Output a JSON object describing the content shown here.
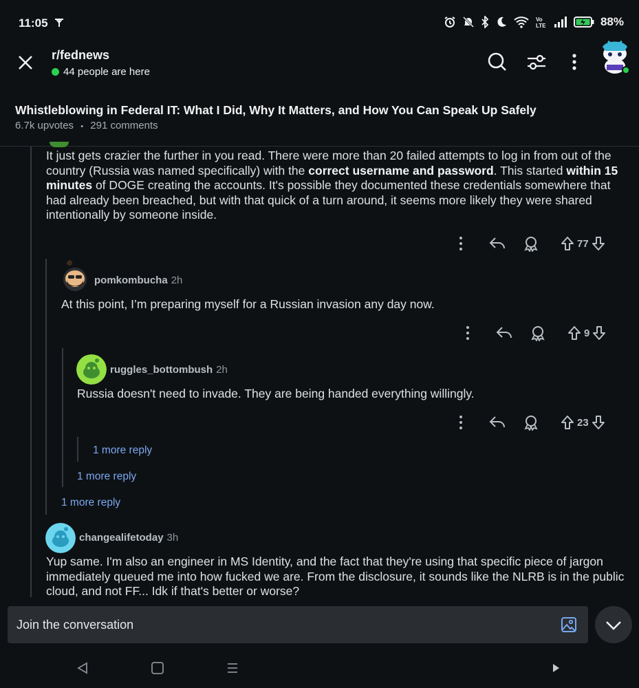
{
  "status_bar": {
    "time": "11:05",
    "battery": "88%"
  },
  "header": {
    "subreddit": "r/fednews",
    "online": "44 people are here"
  },
  "post": {
    "title": "Whistleblowing in Federal IT: What I Did, Why It Matters, and How You Can Speak Up Safely",
    "upvotes": "6.7k upvotes",
    "separator": "•",
    "comments": "291 comments"
  },
  "comments": [
    {
      "text_parts": [
        "It just gets crazier the further in you read. There were more than 20 failed attempts to log in from out of the country (Russia was named specifically) with the ",
        "correct username and password",
        ". This started ",
        "within 15 minutes",
        " of DOGE creating the accounts. It's possible they documented these credentials somewhere that had already been breached, but with that quick of a turn around, it seems more likely they were shared intentionally by someone inside."
      ],
      "votes": "77"
    },
    {
      "author": "pomkombucha",
      "age": "2h",
      "text": "At this point, I’m preparing myself for a Russian invasion any day now.",
      "votes": "9"
    },
    {
      "author": "ruggles_bottombush",
      "age": "2h",
      "text": "Russia doesn't need to invade. They are being handed everything willingly.",
      "votes": "23"
    },
    {
      "author": "changealifetoday",
      "age": "3h",
      "text": "Yup same. I'm also an engineer in MS Identity, and the fact that they're using that specific piece of jargon immediately queued me into how fucked we are. From the disclosure, it sounds like the NLRB is in the public cloud, and not FF... Idk if that's better or worse?"
    }
  ],
  "more_replies": [
    "1 more reply",
    "1 more reply",
    "1 more reply"
  ],
  "composer": {
    "placeholder": "Join the conversation"
  },
  "colors": {
    "accent_link": "#7aa7f0",
    "online_dot": "#2bd14f",
    "background": "#0e1114"
  }
}
